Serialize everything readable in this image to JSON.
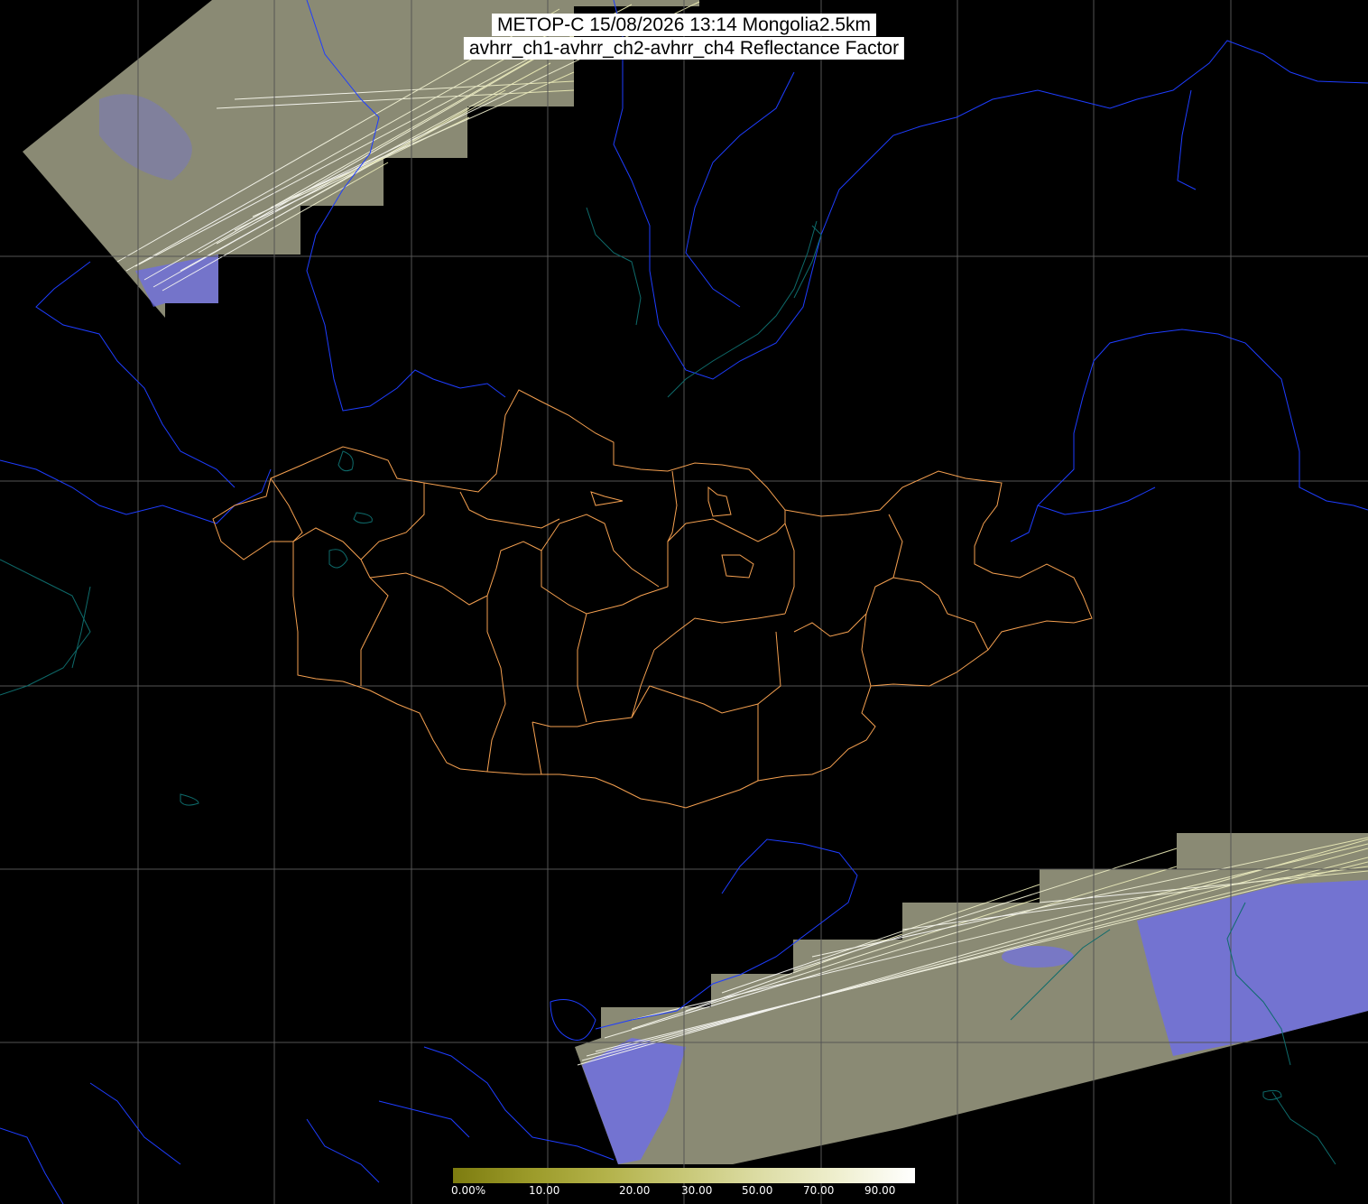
{
  "header": {
    "title": "METOP-C 15/08/2026 13:14 Mongolia2.5km",
    "subtitle": "avhrr_ch1-avhrr_ch2-avhrr_ch4 Reflectance Factor"
  },
  "colorbar": {
    "labels": [
      "0.00%",
      "10.00",
      "20.00",
      "30.00",
      "50.00",
      "70.00",
      "90.00"
    ],
    "colors": [
      "#7d7c10",
      "#9c9b2a",
      "#b3b24a",
      "#c8c877",
      "#dddda6",
      "#efefce",
      "#ffffff"
    ]
  },
  "colors": {
    "grid": "#555555",
    "coastline": "#1e3dff",
    "rivers": "#0e6b6b",
    "admin_border": "#f5a050",
    "swath": "#8a8a74",
    "cloud": "#6b6bf0"
  }
}
